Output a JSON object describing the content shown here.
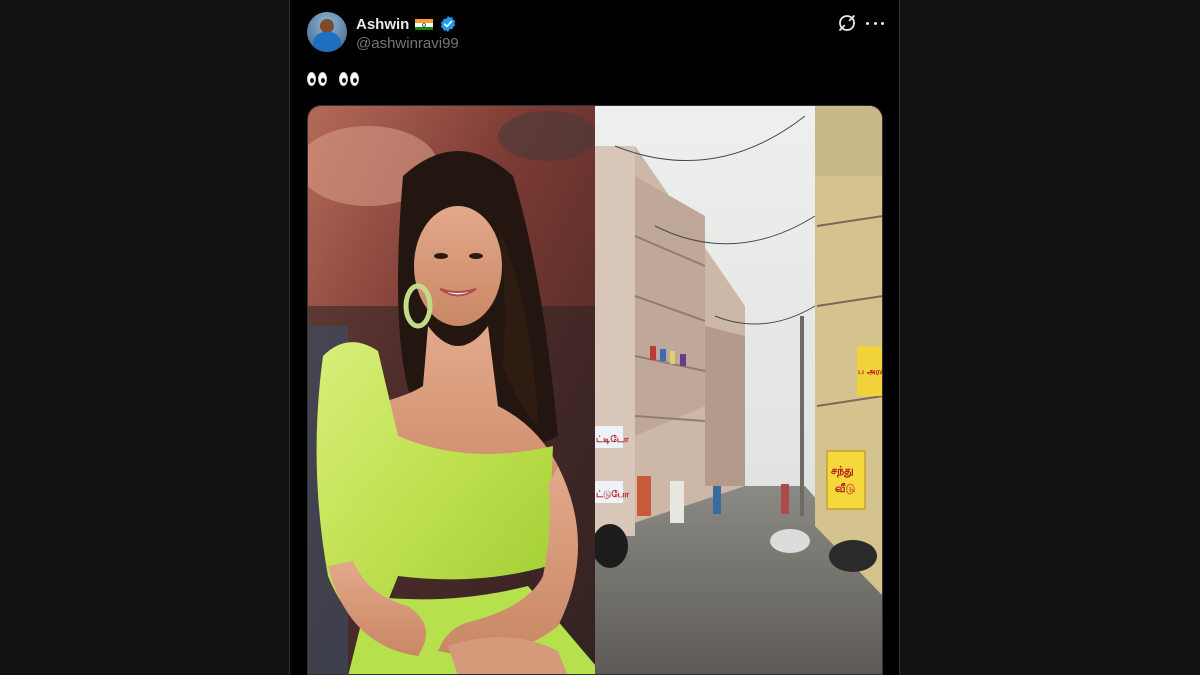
{
  "post": {
    "author": {
      "display_name": "Ashwin",
      "handle": "@ashwinravi99",
      "flag": "india-flag",
      "verified": true
    },
    "text_suffix": "",
    "media": {
      "count": 2,
      "signs": {
        "shop_sign_line1": "சந்து",
        "shop_sign_line2": "வீடு",
        "upper_sign": "ப அரக்",
        "left_sign_1": "ட்டிடோ",
        "left_sign_2": "ட்டுபோ"
      }
    }
  },
  "colors": {
    "background": "#000000",
    "text_primary": "#e7e9ea",
    "text_secondary": "#71767b",
    "verified_blue": "#1d9bf0",
    "dress_green": "#c8e65a"
  },
  "icons": {
    "grok": "grok-icon",
    "more": "more-options-icon",
    "verified": "verified-badge-icon",
    "eyes": "eyes-emoji"
  }
}
